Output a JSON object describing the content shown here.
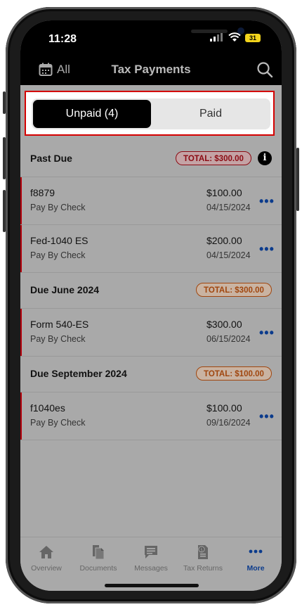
{
  "status": {
    "time": "11:28",
    "battery": "31"
  },
  "nav": {
    "filter_label": "All",
    "title": "Tax Payments"
  },
  "segment": {
    "unpaid_label": "Unpaid (4)",
    "paid_label": "Paid"
  },
  "sections": [
    {
      "title": "Past Due",
      "total": "TOTAL: $300.00",
      "items": [
        {
          "name": "f8879",
          "method": "Pay By Check",
          "amount": "$100.00",
          "date": "04/15/2024"
        },
        {
          "name": "Fed-1040 ES",
          "method": "Pay By Check",
          "amount": "$200.00",
          "date": "04/15/2024"
        }
      ]
    },
    {
      "title": "Due June 2024",
      "total": "TOTAL: $300.00",
      "items": [
        {
          "name": "Form 540-ES",
          "method": "Pay By Check",
          "amount": "$300.00",
          "date": "06/15/2024"
        }
      ]
    },
    {
      "title": "Due September 2024",
      "total": "TOTAL: $100.00",
      "items": [
        {
          "name": "f1040es",
          "method": "Pay By Check",
          "amount": "$100.00",
          "date": "09/16/2024"
        }
      ]
    }
  ],
  "tabs": [
    {
      "label": "Overview",
      "icon": "home-icon"
    },
    {
      "label": "Documents",
      "icon": "documents-icon"
    },
    {
      "label": "Messages",
      "icon": "messages-icon"
    },
    {
      "label": "Tax Returns",
      "icon": "tax-returns-icon"
    },
    {
      "label": "More",
      "icon": "more-icon"
    }
  ],
  "colors": {
    "past_due_red": "#8b0a12",
    "upcoming_orange": "#a0460e",
    "accent_blue": "#0b3b8c",
    "highlight_box": "#d40000"
  }
}
